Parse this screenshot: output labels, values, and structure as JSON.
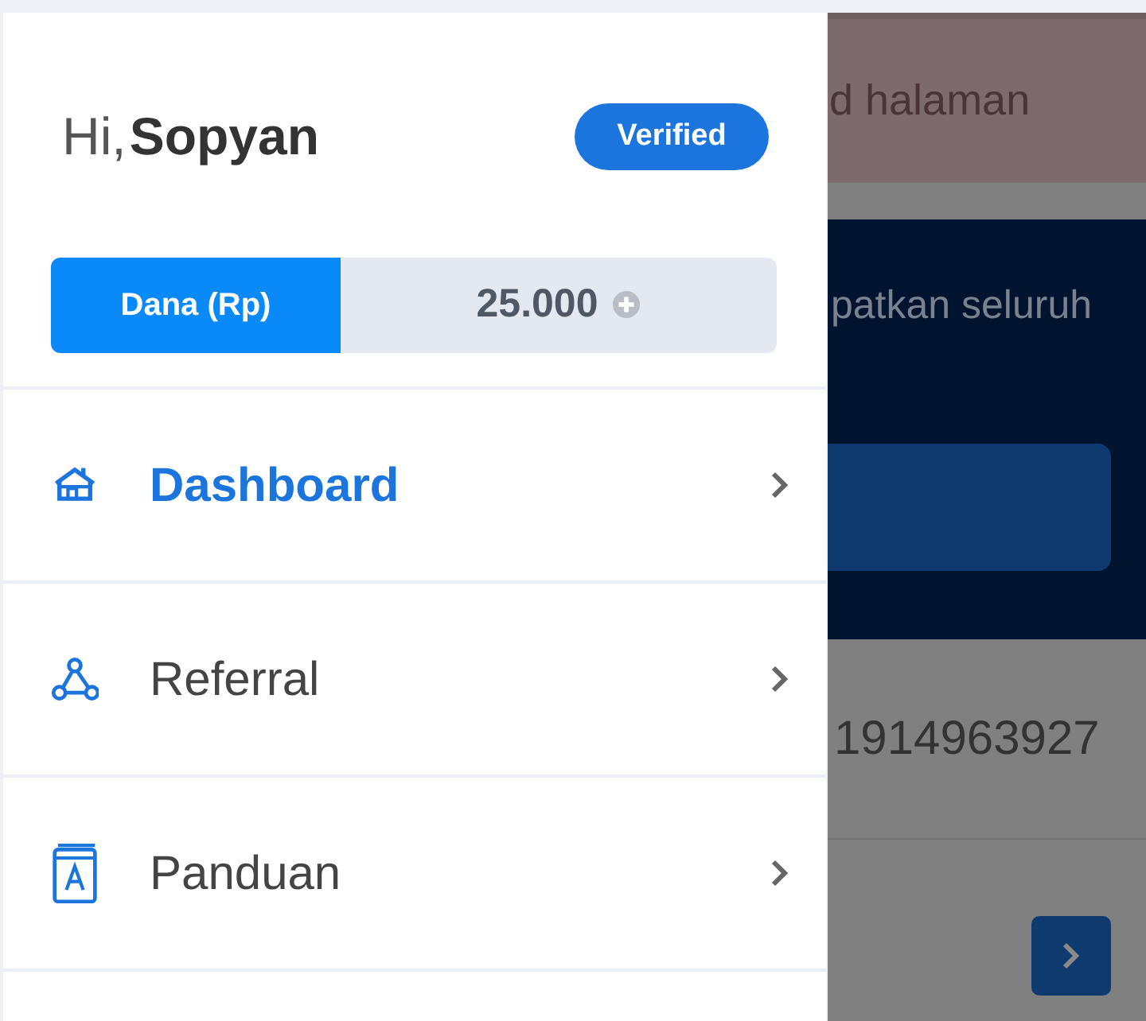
{
  "drawer": {
    "greeting": "Hi,",
    "user_name": "Sopyan",
    "badge": "Verified",
    "balance": {
      "label": "Dana (Rp)",
      "value": "25.000"
    },
    "menu": [
      {
        "label": "Dashboard",
        "kind": "home",
        "selected": true
      },
      {
        "label": "Referral",
        "kind": "referral",
        "selected": false
      },
      {
        "label": "Panduan",
        "kind": "guide",
        "selected": false
      }
    ]
  },
  "background_page": {
    "notice": "d halaman",
    "banner_text": "patkan seluruh",
    "number": "1914963927"
  }
}
